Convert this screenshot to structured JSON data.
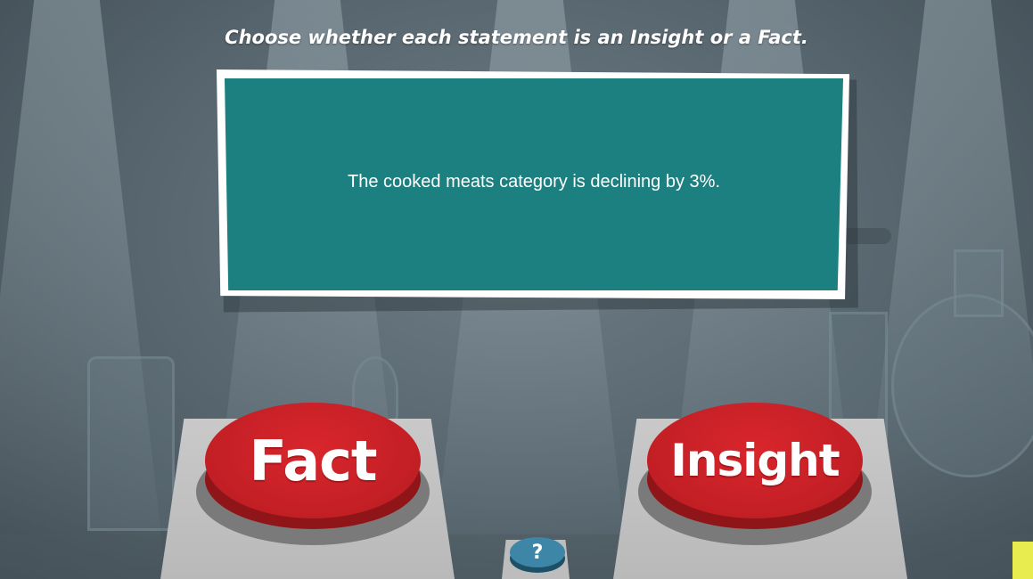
{
  "instruction": "Choose whether each statement is an Insight or a Fact.",
  "statement": "The cooked meats category is declining by 3%.",
  "buttons": {
    "fact_label": "Fact",
    "insight_label": "Insight",
    "help_label": "?"
  },
  "icons": {
    "help": "question-mark-icon"
  },
  "colors": {
    "card_bg": "#1c8080",
    "card_border": "#ffffff",
    "button_red": "#c21f25",
    "help_blue": "#3d86a8",
    "accent_yellow": "#e8ec4f"
  }
}
